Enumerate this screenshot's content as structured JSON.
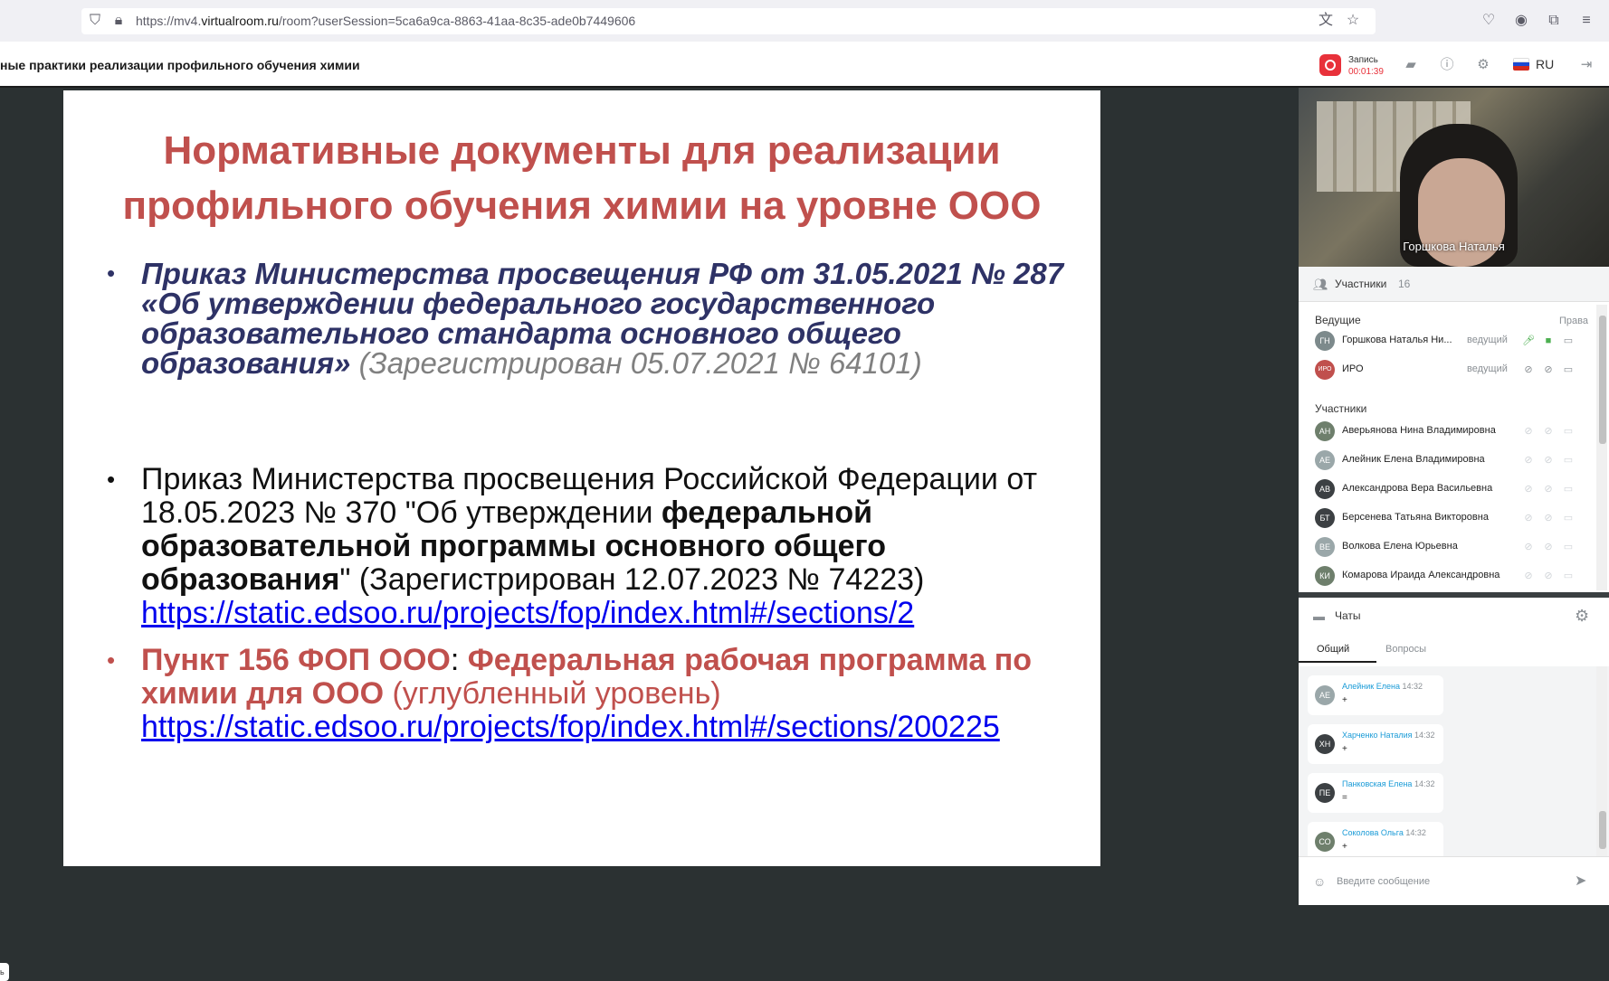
{
  "browser": {
    "url_prefix": "https://mv4.",
    "url_domain": "virtualroom.ru",
    "url_suffix": "/room?userSession=5ca6a9ca-8863-41aa-8c35-ade0b7449606"
  },
  "header": {
    "title": "ные практики реализации профильного обучения химии",
    "record_label": "Запись",
    "record_time": "00:01:39",
    "language": "RU"
  },
  "slide": {
    "title_line1": "Нормативные документы для реализации",
    "title_line2": "профильного обучения химии на уровне ООО",
    "bullet1_main": "Приказ Министерства просвещения РФ от 31.05.2021 № 287 «Об утверждении федерального государственного образовательного стандарта основного  общего образования»",
    "bullet1_reg": "(Зарегистрирован 05.07.2021 № 64101)",
    "bullet2_text": "Приказ Министерства просвещения Российской Федерации от 18.05.2023 № 370 \"Об утверждении ",
    "bullet2_bold": "федеральной образовательной программы основного общего образования",
    "bullet2_tail": "\" (Зарегистрирован 12.07.2023 № 74223)",
    "bullet2_link": "https://static.edsoo.ru/projects/fop/index.html#/sections/2",
    "bullet3_label": "Пункт 156 ФОП ООО",
    "bullet3_colon": ": ",
    "bullet3_bold": "Федеральная рабочая программа по химии для ООО",
    "bullet3_tail": " (углубленный уровень)",
    "bullet3_link": "https://static.edsoo.ru/projects/fop/index.html#/sections/200225"
  },
  "video": {
    "name": "Горшкова Наталья"
  },
  "participants": {
    "header_label": "Участники",
    "count": "16",
    "hosts_label": "Ведущие",
    "rights_label": "Права",
    "members_label": "Участники",
    "hosts": [
      {
        "initials": "ГН",
        "name": "Горшкова Наталья Ни...",
        "role": "ведущий",
        "color": "#7d8a8c"
      },
      {
        "initials": "ИРО",
        "name": "ИРО",
        "role": "ведущий",
        "color": "#c0504d"
      }
    ],
    "members": [
      {
        "initials": "АН",
        "name": "Аверьянова Нина Владимировна",
        "color": "#6e7f6c"
      },
      {
        "initials": "АЕ",
        "name": "Алейник Елена Владимировна",
        "color": "#9aa7a9"
      },
      {
        "initials": "АВ",
        "name": "Александрова Вера Васильевна",
        "color": "#3c4043"
      },
      {
        "initials": "БТ",
        "name": "Берсенева Татьяна Викторовна",
        "color": "#3c4043"
      },
      {
        "initials": "ВЕ",
        "name": "Волкова Елена Юрьевна",
        "color": "#9aa7a9"
      },
      {
        "initials": "КИ",
        "name": "Комарова Ираида Александровна",
        "color": "#6e7f6c"
      }
    ]
  },
  "chat": {
    "header_label": "Чаты",
    "tab_general": "Общий",
    "tab_questions": "Вопросы",
    "messages": [
      {
        "initials": "АЕ",
        "name": "Алейник Елена",
        "time": "14:32",
        "text": "+"
      },
      {
        "initials": "ХН",
        "name": "Харченко Наталия",
        "time": "14:32",
        "text": "+"
      },
      {
        "initials": "ПЕ",
        "name": "Панковская Елена",
        "time": "14:32",
        "text": "="
      },
      {
        "initials": "СО",
        "name": "Соколова Ольга",
        "time": "14:32",
        "text": "+"
      }
    ],
    "input_placeholder": "Введите сообщение"
  },
  "colors": {
    "accent_red": "#c0504d",
    "slide_navy": "#2e3266",
    "link_blue": "#0000ee",
    "record_red": "#e8313a"
  }
}
